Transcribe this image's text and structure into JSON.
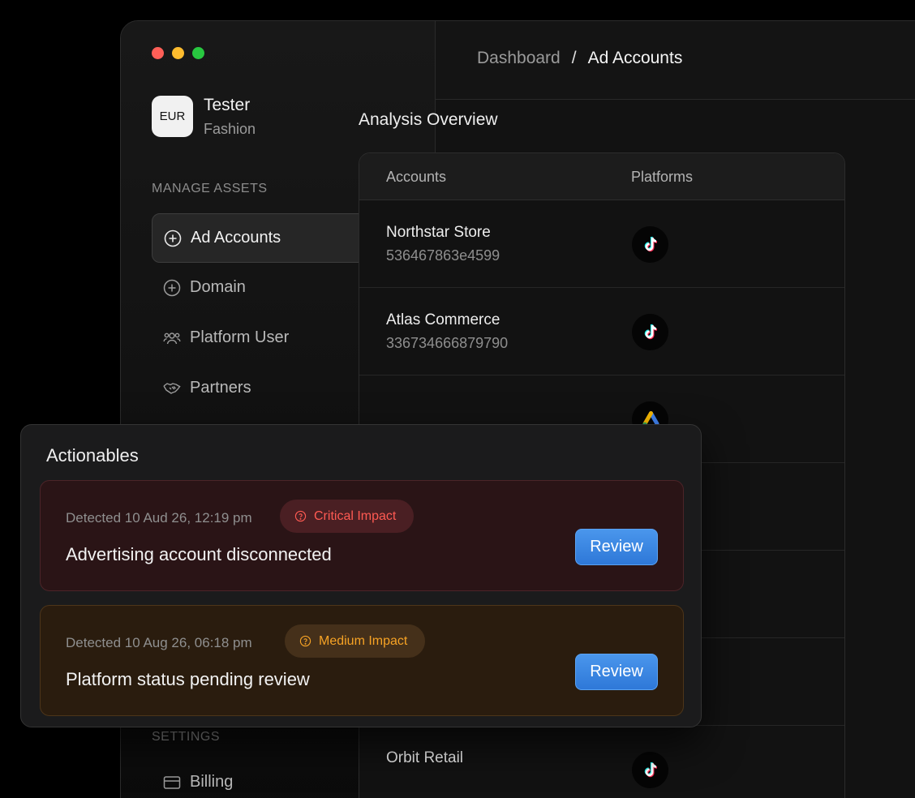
{
  "window": {
    "traffic_lights": [
      "close",
      "minimize",
      "zoom"
    ]
  },
  "org": {
    "currency": "EUR",
    "name": "Tester",
    "subtitle": "Fashion"
  },
  "sidebar": {
    "manage_label": "MANAGE ASSETS",
    "items": [
      {
        "label": "Ad Accounts",
        "icon": "plus-circle-icon",
        "active": true
      },
      {
        "label": "Domain",
        "icon": "plus-circle-icon",
        "active": false
      },
      {
        "label": "Platform User",
        "icon": "users-icon",
        "active": false
      },
      {
        "label": "Partners",
        "icon": "handshake-icon",
        "active": false
      }
    ],
    "settings_label": "SETTINGS",
    "settings_items": [
      {
        "label": "Billing",
        "icon": "credit-card-icon"
      }
    ]
  },
  "header": {
    "breadcrumb_parent": "Dashboard",
    "breadcrumb_sep": "/",
    "breadcrumb_current": "Ad Accounts"
  },
  "main": {
    "title": "Analysis Overview",
    "columns": [
      "Accounts",
      "Platforms"
    ],
    "rows": [
      {
        "name": "Northstar Store",
        "id": "536467863e4599",
        "platform": "tiktok-icon"
      },
      {
        "name": "Atlas Commerce",
        "id": "336734666879790",
        "platform": "tiktok-icon"
      },
      {
        "name": "",
        "id": "",
        "platform": "google-ads-icon"
      },
      {
        "name": "",
        "id": "",
        "platform": "google-ads-icon"
      },
      {
        "name": "",
        "id": "",
        "platform": "tiktok-icon"
      },
      {
        "name": "",
        "id": "",
        "platform": "google-ads-icon"
      },
      {
        "name": "Orbit Retail",
        "id": "",
        "platform": "tiktok-icon"
      }
    ]
  },
  "actionables": {
    "title": "Actionables",
    "items": [
      {
        "detected": "Detected 10 Aud 26, 12:19 pm",
        "impact": "Critical Impact",
        "text": "Advertising account disconnected",
        "button": "Review",
        "impact_color": "#ff5a52"
      },
      {
        "detected": "Detected 10 Aug 26, 06:18 pm",
        "impact": "Medium Impact",
        "text": "Platform status pending review",
        "button": "Review",
        "impact_color": "#f7a325"
      }
    ]
  }
}
